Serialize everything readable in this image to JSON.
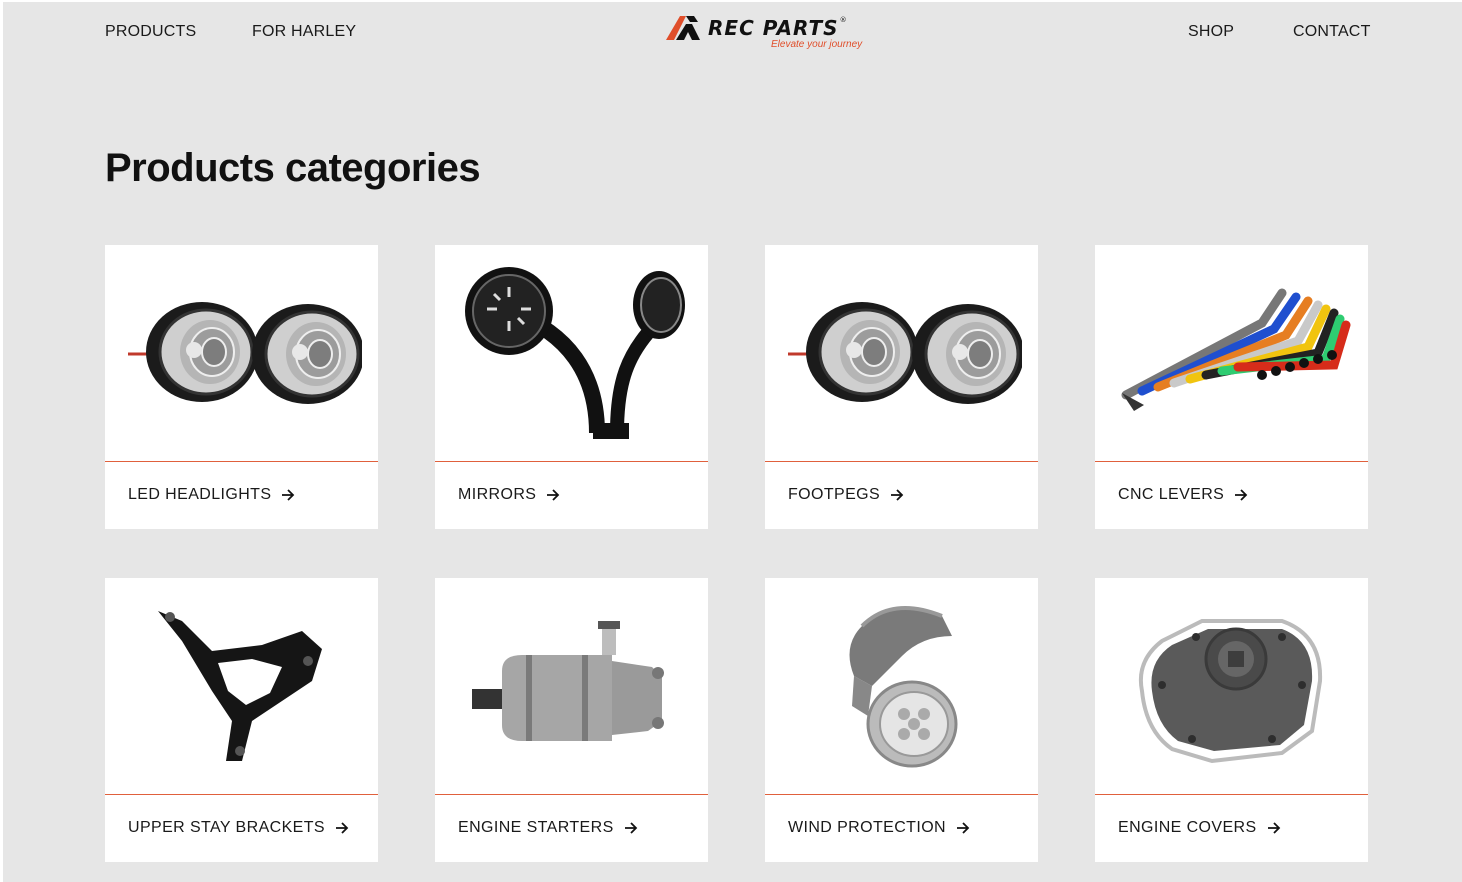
{
  "nav": {
    "left": [
      "PRODUCTS",
      "FOR HARLEY"
    ],
    "right": [
      "SHOP",
      "CONTACT"
    ]
  },
  "logo": {
    "brand": "REC PARTS",
    "registered": "®",
    "tagline": "Elevate your journey",
    "accent": "#e04e2a"
  },
  "page_title": "Products categories",
  "categories": [
    {
      "label": "LED HEADLIGHTS",
      "icon": "led-headlights-image"
    },
    {
      "label": "MIRRORS",
      "icon": "mirrors-image"
    },
    {
      "label": "FOOTPEGS",
      "icon": "footpegs-image"
    },
    {
      "label": "CNC LEVERS",
      "icon": "cnc-levers-image"
    },
    {
      "label": "UPPER STAY BRACKETS",
      "icon": "upper-stay-bracket-image"
    },
    {
      "label": "ENGINE STARTERS",
      "icon": "engine-starter-image"
    },
    {
      "label": "WIND PROTECTION",
      "icon": "wind-protection-image"
    },
    {
      "label": "ENGINE COVERS",
      "icon": "engine-cover-image"
    }
  ],
  "colors": {
    "background": "#e6e6e6",
    "card": "#ffffff",
    "divider": "#e0603c",
    "text": "#111111"
  }
}
